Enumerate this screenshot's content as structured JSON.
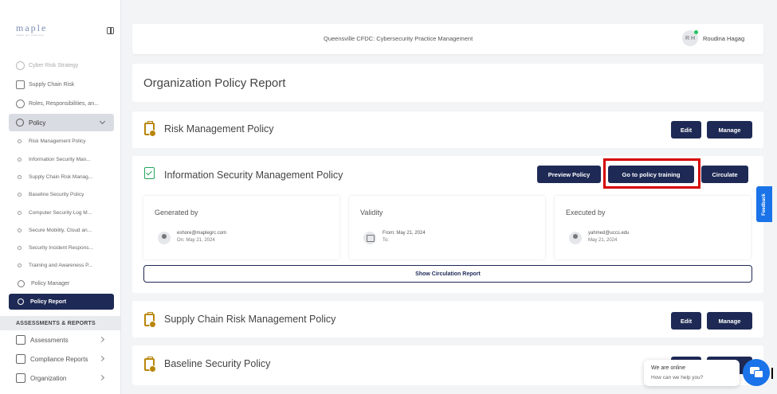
{
  "sidebar": {
    "logo": "maple",
    "logo_sub": "maple grc solutions",
    "items": [
      {
        "label": "Cyber Risk Strategy",
        "icon": "question-icon",
        "dim": true
      },
      {
        "label": "Supply Chain Risk",
        "icon": "supply-chain-icon"
      },
      {
        "label": "Roles, Responsibilities, an...",
        "icon": "roles-icon"
      }
    ],
    "policy_label": "Policy",
    "policy_sub_items": [
      "Risk Management Policy",
      "Information Security Man...",
      "Supply Chain Risk Manag...",
      "Baseline Security Policy",
      "Computer Security Log M...",
      "Secure Mobility, Cloud an...",
      "Security Incident Respons...",
      "Training and Awareness P..."
    ],
    "policy_manager_label": "Policy Manager",
    "policy_report_label": "Policy Report",
    "section_header": "ASSESSMENTS & REPORTS",
    "bottom_items": [
      {
        "label": "Assessments",
        "icon": "assessments-icon"
      },
      {
        "label": "Compliance Reports",
        "icon": "compliance-reports-icon"
      },
      {
        "label": "Organization",
        "icon": "organization-icon"
      }
    ]
  },
  "header": {
    "org": "Queensville CFDC: Cybersecurity Practice Management",
    "avatar_initials": "R H",
    "user_name": "Roudina Hagag"
  },
  "page_title": "Organization Policy Report",
  "policies": {
    "risk": {
      "title": "Risk Management Policy",
      "edit": "Edit",
      "manage": "Manage"
    },
    "infosec": {
      "title": "Information Security Management Policy",
      "preview": "Preview Policy",
      "training": "Go to policy training",
      "circulate": "Circulate",
      "generated_by": {
        "header": "Generated by",
        "email": "eshore@maplegrc.com",
        "date": "On: May 21, 2024"
      },
      "validity": {
        "header": "Validity",
        "from": "From: May 21, 2024",
        "to": "To:"
      },
      "executed_by": {
        "header": "Executed by",
        "email": "yahmed@uccs.edu",
        "date": "May 21, 2024"
      },
      "show_report": "Show Circulation Report"
    },
    "supply": {
      "title": "Supply Chain Risk Management Policy",
      "edit": "Edit",
      "manage": "Manage"
    },
    "baseline": {
      "title": "Baseline Security Policy"
    }
  },
  "feedback_label": "Feedback",
  "chat": {
    "line1": "We are online",
    "line2": "How can we help you?"
  },
  "colors": {
    "primary": "#1e2a55",
    "highlight": "#d60000",
    "feedback": "#1a73e8"
  }
}
